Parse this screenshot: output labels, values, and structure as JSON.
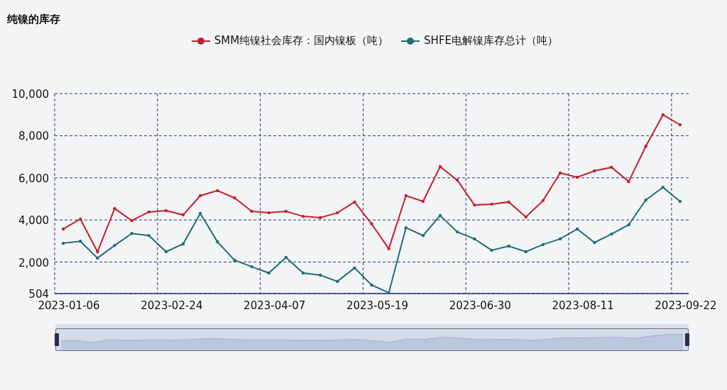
{
  "title": "纯镍的库存",
  "chart_data": {
    "type": "line",
    "grid": true,
    "categories": [
      "2023-01-06",
      null,
      null,
      null,
      null,
      null,
      "2023-02-24",
      null,
      null,
      null,
      null,
      null,
      "2023-04-07",
      null,
      null,
      null,
      null,
      null,
      "2023-05-19",
      null,
      null,
      null,
      null,
      null,
      "2023-06-30",
      null,
      null,
      null,
      null,
      null,
      "2023-08-11",
      null,
      null,
      null,
      null,
      null,
      "2023-09-22"
    ],
    "series": [
      {
        "name": "SMM纯镍社会库存：国内镍板（吨）",
        "color": "#c4212c",
        "values": [
          3570,
          4040,
          2490,
          4540,
          3970,
          4380,
          4440,
          4240,
          5150,
          5390,
          5050,
          4410,
          4340,
          4410,
          4170,
          4110,
          4340,
          4850,
          3810,
          2630,
          5150,
          4880,
          6530,
          5890,
          4710,
          4750,
          4850,
          4140,
          4920,
          6230,
          6030,
          6330,
          6500,
          5820,
          7500,
          8990,
          8520
        ]
      },
      {
        "name": "SHFE电解镍库存总计（吨）",
        "color": "#206e78",
        "values": [
          2890,
          2990,
          2190,
          2790,
          3360,
          3260,
          2490,
          2860,
          4310,
          2960,
          2090,
          1780,
          1480,
          2220,
          1480,
          1380,
          1080,
          1720,
          910,
          540,
          3630,
          3260,
          4210,
          3430,
          3100,
          2560,
          2760,
          2490,
          2830,
          3100,
          3570,
          2930,
          3330,
          3770,
          4950,
          5550,
          4880
        ]
      }
    ],
    "ylim": [
      504,
      10000
    ],
    "yticks": [
      504,
      {
        "value": 2000,
        "label": "2,000"
      },
      {
        "value": 4000,
        "label": "4,000"
      },
      {
        "value": 6000,
        "label": "6,000"
      },
      {
        "value": 8000,
        "label": "8,000"
      },
      {
        "value": 10000,
        "label": "10,000"
      }
    ]
  },
  "zoom_slider": {
    "level": 1
  }
}
